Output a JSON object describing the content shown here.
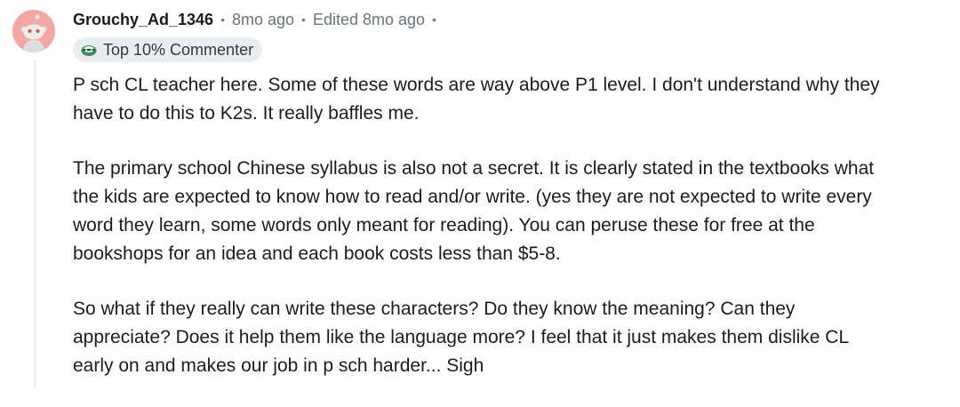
{
  "comment": {
    "username": "Grouchy_Ad_1346",
    "time": "8mo ago",
    "edited": "Edited 8mo ago",
    "separator": "•",
    "flair": "Top 10% Commenter",
    "paragraphs": [
      {
        "lines": [
          "P sch CL teacher here. Some of these words are way above P1 level. I don't understand why they",
          "have to do this to K2s. It really baffles me."
        ]
      },
      {
        "lines": [
          "The primary school Chinese syllabus is also not a secret. It is clearly stated in the textbooks what",
          "the kids are expected to know how to read and/or write. (yes they are not expected to write every",
          "word they learn, some words only meant for reading). You can peruse these for free at the",
          "bookshops for an idea and each book costs less than $5-8."
        ]
      },
      {
        "lines": [
          "So what if they really can write these characters? Do they know the meaning? Can they",
          "appreciate? Does it help them like the language more? I feel that it just makes them dislike CL",
          "early on and makes our job in p sch harder... Sigh"
        ]
      }
    ]
  },
  "colors": {
    "avatar_bg": "#f4a8a4",
    "flair_bg": "#eaedef",
    "meta_text": "#6a7479",
    "body_text": "#1c1c1c"
  },
  "icons": {
    "avatar": "reddit-snoo-avatar-icon",
    "flair": "top-commenter-badge-icon"
  }
}
